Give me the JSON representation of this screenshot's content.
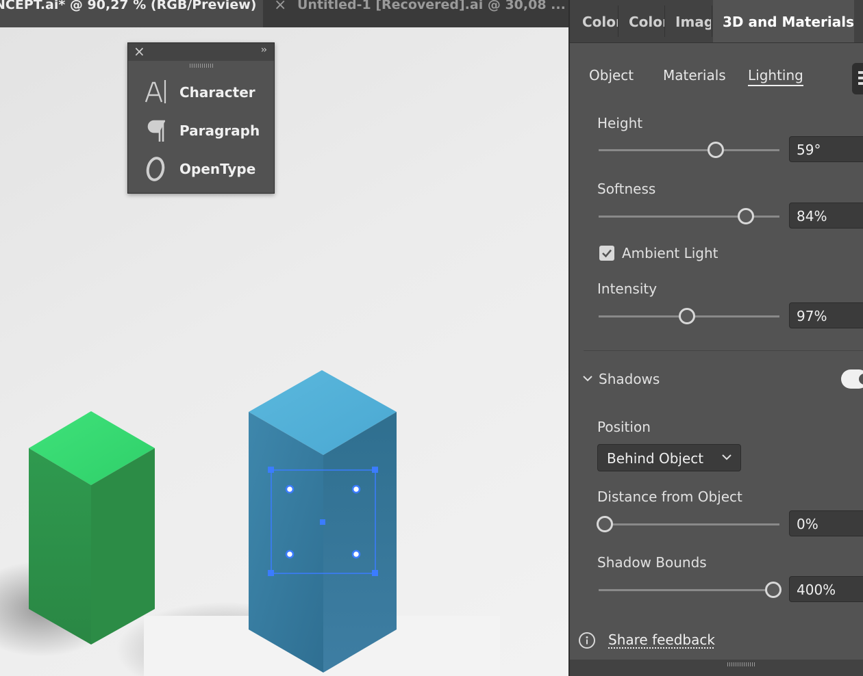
{
  "document_tabs": {
    "active": "NCEPT.ai* @ 90,27 % (RGB/Preview)",
    "inactive_close": "×",
    "inactive": "Untitled-1 [Recovered].ai @ 30,08 ..."
  },
  "type_panel": {
    "close": "×",
    "collapse": "››",
    "items": [
      {
        "label": "Character",
        "icon": "character-icon"
      },
      {
        "label": "Paragraph",
        "icon": "paragraph-icon"
      },
      {
        "label": "OpenType",
        "icon": "opentype-icon"
      }
    ]
  },
  "right_panel": {
    "tabs": [
      "Color",
      "Color",
      "Imag",
      "3D and Materials"
    ],
    "active_tab": "3D and Materials",
    "subtabs": [
      "Object",
      "Materials",
      "Lighting"
    ],
    "active_subtab": "Lighting",
    "height": {
      "label": "Height",
      "value": "59°",
      "fraction": 0.64
    },
    "softness": {
      "label": "Softness",
      "value": "84%",
      "fraction": 0.84
    },
    "ambient": {
      "label": "Ambient Light",
      "checked": true
    },
    "intensity": {
      "label": "Intensity",
      "value": "97%",
      "fraction": 0.48
    },
    "shadows": {
      "label": "Shadows",
      "enabled": true
    },
    "position": {
      "label": "Position",
      "value": "Behind Object"
    },
    "distance": {
      "label": "Distance from Object",
      "value": "0%",
      "fraction": 0.0
    },
    "bounds": {
      "label": "Shadow Bounds",
      "value": "400%",
      "fraction": 0.96
    },
    "feedback": "Share feedback"
  },
  "colors": {
    "green_box": "#35b35e",
    "blue_box": "#3f8fb5",
    "selection": "#3b7cff"
  }
}
